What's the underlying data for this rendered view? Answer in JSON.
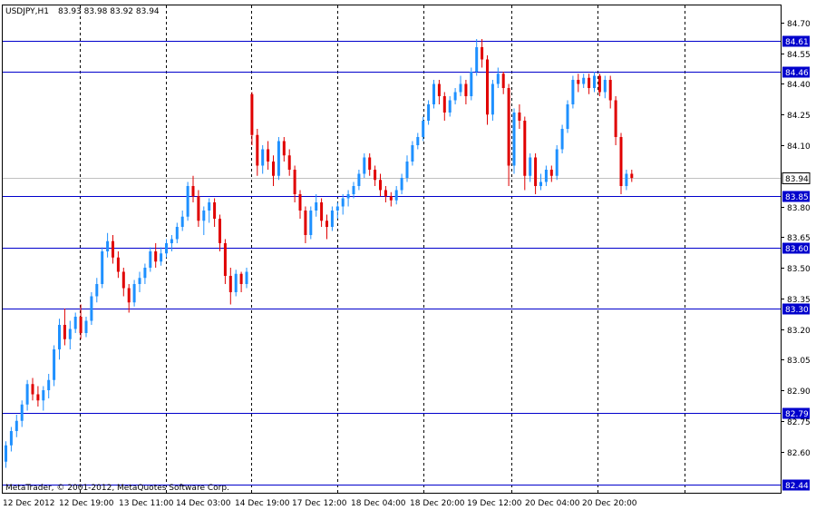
{
  "window": {
    "symbol_label": "USDJPY,H1",
    "ohlc": "83.93 83.98 83.92 83.94"
  },
  "copyright": "MetaTrader, © 2001-2012, MetaQuotes Software Corp.",
  "colors": {
    "up": "#1E90FF",
    "down": "#E00000",
    "level": "#0000CC",
    "grid": "#000000",
    "axis": "#000000",
    "current_price_line": "#C0C0C0",
    "label_text": "#ffffff"
  },
  "chart_data": {
    "type": "candlestick",
    "symbol": "USDJPY",
    "timeframe": "H1",
    "ylim": [
      82.44,
      84.72
    ],
    "price_ticks": [
      "84.70",
      "84.55",
      "84.40",
      "84.25",
      "84.10",
      "83.80",
      "83.65",
      "83.50",
      "83.35",
      "83.20",
      "83.05",
      "82.90",
      "82.75",
      "82.60"
    ],
    "time_labels": [
      "12 Dec 2012",
      "12 Dec 19:00",
      "13 Dec 11:00",
      "14 Dec 03:00",
      "14 Dec 19:00",
      "17 Dec 12:00",
      "18 Dec 04:00",
      "18 Dec 20:00",
      "19 Dec 12:00",
      "20 Dec 04:00",
      "20 Dec 20:00"
    ],
    "levels": [
      "84.61",
      "84.46",
      "83.85",
      "83.60",
      "83.30",
      "82.79",
      "82.44"
    ],
    "current_price": "83.94",
    "grid": true,
    "candles_ohlc": [
      [
        82.55,
        82.65,
        82.52,
        82.63
      ],
      [
        82.63,
        82.72,
        82.6,
        82.7
      ],
      [
        82.7,
        82.78,
        82.67,
        82.75
      ],
      [
        82.75,
        82.85,
        82.72,
        82.83
      ],
      [
        82.83,
        82.95,
        82.8,
        82.93
      ],
      [
        82.93,
        82.96,
        82.85,
        82.88
      ],
      [
        82.88,
        82.92,
        82.82,
        82.85
      ],
      [
        82.85,
        82.92,
        82.8,
        82.9
      ],
      [
        82.9,
        82.98,
        82.86,
        82.95
      ],
      [
        82.95,
        83.12,
        82.92,
        83.1
      ],
      [
        83.1,
        83.25,
        83.05,
        83.22
      ],
      [
        83.22,
        83.3,
        83.12,
        83.15
      ],
      [
        83.15,
        83.24,
        83.1,
        83.2
      ],
      [
        83.2,
        83.28,
        83.18,
        83.26
      ],
      [
        83.26,
        83.32,
        83.15,
        83.18
      ],
      [
        83.18,
        83.26,
        83.16,
        83.24
      ],
      [
        83.24,
        83.38,
        83.22,
        83.36
      ],
      [
        83.36,
        83.45,
        83.33,
        83.42
      ],
      [
        83.42,
        83.6,
        83.4,
        83.58
      ],
      [
        83.58,
        83.67,
        83.55,
        83.63
      ],
      [
        83.63,
        83.66,
        83.52,
        83.55
      ],
      [
        83.55,
        83.58,
        83.45,
        83.48
      ],
      [
        83.48,
        83.5,
        83.36,
        83.4
      ],
      [
        83.4,
        83.42,
        83.28,
        83.33
      ],
      [
        83.33,
        83.44,
        83.31,
        83.42
      ],
      [
        83.42,
        83.48,
        83.38,
        83.45
      ],
      [
        83.45,
        83.52,
        83.42,
        83.5
      ],
      [
        83.5,
        83.6,
        83.48,
        83.58
      ],
      [
        83.58,
        83.62,
        83.5,
        83.53
      ],
      [
        83.53,
        83.6,
        83.51,
        83.57
      ],
      [
        83.57,
        83.64,
        83.55,
        83.62
      ],
      [
        83.62,
        83.66,
        83.58,
        83.64
      ],
      [
        83.64,
        83.72,
        83.62,
        83.7
      ],
      [
        83.7,
        83.78,
        83.68,
        83.75
      ],
      [
        83.75,
        83.92,
        83.73,
        83.9
      ],
      [
        83.9,
        83.95,
        83.82,
        83.85
      ],
      [
        83.85,
        83.88,
        83.7,
        83.73
      ],
      [
        83.73,
        83.8,
        83.66,
        83.78
      ],
      [
        83.78,
        83.84,
        83.72,
        83.82
      ],
      [
        83.82,
        83.84,
        83.7,
        83.74
      ],
      [
        83.74,
        83.76,
        83.58,
        83.62
      ],
      [
        83.62,
        83.64,
        83.42,
        83.46
      ],
      [
        83.46,
        83.5,
        83.32,
        83.38
      ],
      [
        83.38,
        83.49,
        83.36,
        83.47
      ],
      [
        83.47,
        83.48,
        83.38,
        83.42
      ],
      [
        83.42,
        83.5,
        83.4,
        83.48
      ],
      [
        84.35,
        84.36,
        84.1,
        84.15
      ],
      [
        84.15,
        84.18,
        83.95,
        84.0
      ],
      [
        84.0,
        84.1,
        83.96,
        84.08
      ],
      [
        84.08,
        84.12,
        83.98,
        84.02
      ],
      [
        84.02,
        84.05,
        83.9,
        83.95
      ],
      [
        83.95,
        84.14,
        83.93,
        84.12
      ],
      [
        84.12,
        84.14,
        84.02,
        84.05
      ],
      [
        84.05,
        84.08,
        83.95,
        83.98
      ],
      [
        83.98,
        84.0,
        83.82,
        83.86
      ],
      [
        83.86,
        83.88,
        83.74,
        83.78
      ],
      [
        83.78,
        83.8,
        83.62,
        83.66
      ],
      [
        83.66,
        83.8,
        83.64,
        83.78
      ],
      [
        83.78,
        83.86,
        83.75,
        83.82
      ],
      [
        83.82,
        83.84,
        83.7,
        83.73
      ],
      [
        83.73,
        83.76,
        83.64,
        83.7
      ],
      [
        83.7,
        83.8,
        83.68,
        83.78
      ],
      [
        83.78,
        83.82,
        83.74,
        83.8
      ],
      [
        83.8,
        83.86,
        83.76,
        83.84
      ],
      [
        83.84,
        83.88,
        83.8,
        83.86
      ],
      [
        83.86,
        83.92,
        83.84,
        83.9
      ],
      [
        83.9,
        83.98,
        83.88,
        83.96
      ],
      [
        83.96,
        84.06,
        83.94,
        84.04
      ],
      [
        84.04,
        84.06,
        83.95,
        83.98
      ],
      [
        83.98,
        84.0,
        83.9,
        83.93
      ],
      [
        83.93,
        83.96,
        83.85,
        83.88
      ],
      [
        83.88,
        83.9,
        83.82,
        83.85
      ],
      [
        83.85,
        83.87,
        83.8,
        83.83
      ],
      [
        83.83,
        83.9,
        83.81,
        83.88
      ],
      [
        83.88,
        83.96,
        83.86,
        83.94
      ],
      [
        83.94,
        84.05,
        83.92,
        84.02
      ],
      [
        84.02,
        84.12,
        84.0,
        84.1
      ],
      [
        84.1,
        84.16,
        84.08,
        84.14
      ],
      [
        84.14,
        84.24,
        84.12,
        84.22
      ],
      [
        84.22,
        84.32,
        84.2,
        84.3
      ],
      [
        84.3,
        84.42,
        84.28,
        84.4
      ],
      [
        84.4,
        84.42,
        84.3,
        84.34
      ],
      [
        84.34,
        84.36,
        84.22,
        84.26
      ],
      [
        84.26,
        84.34,
        84.24,
        84.32
      ],
      [
        84.32,
        84.38,
        84.3,
        84.36
      ],
      [
        84.36,
        84.44,
        84.34,
        84.4
      ],
      [
        84.4,
        84.42,
        84.3,
        84.34
      ],
      [
        84.34,
        84.48,
        84.32,
        84.46
      ],
      [
        84.46,
        84.62,
        84.44,
        84.58
      ],
      [
        84.58,
        84.62,
        84.48,
        84.52
      ],
      [
        84.52,
        84.54,
        84.2,
        84.25
      ],
      [
        84.25,
        84.42,
        84.22,
        84.4
      ],
      [
        84.4,
        84.48,
        84.38,
        84.45
      ],
      [
        84.45,
        84.46,
        84.35,
        84.38
      ],
      [
        84.38,
        84.4,
        83.9,
        84.0
      ],
      [
        84.0,
        84.28,
        83.96,
        84.26
      ],
      [
        84.26,
        84.3,
        84.18,
        84.22
      ],
      [
        84.22,
        84.24,
        83.88,
        83.95
      ],
      [
        83.95,
        84.06,
        83.92,
        84.04
      ],
      [
        84.04,
        84.06,
        83.86,
        83.9
      ],
      [
        83.9,
        83.96,
        83.88,
        83.92
      ],
      [
        83.92,
        84.0,
        83.9,
        83.98
      ],
      [
        83.98,
        84.0,
        83.92,
        83.95
      ],
      [
        83.95,
        84.1,
        83.93,
        84.08
      ],
      [
        84.08,
        84.2,
        84.06,
        84.18
      ],
      [
        84.18,
        84.32,
        84.16,
        84.3
      ],
      [
        84.3,
        84.44,
        84.28,
        84.42
      ],
      [
        84.42,
        84.45,
        84.36,
        84.4
      ],
      [
        84.4,
        84.45,
        84.38,
        84.43
      ],
      [
        84.43,
        84.45,
        84.35,
        84.38
      ],
      [
        84.38,
        84.46,
        84.36,
        84.44
      ],
      [
        84.44,
        84.45,
        84.34,
        84.36
      ],
      [
        84.36,
        84.44,
        84.33,
        84.42
      ],
      [
        84.42,
        84.44,
        84.28,
        84.32
      ],
      [
        84.32,
        84.34,
        84.1,
        84.14
      ],
      [
        84.14,
        84.16,
        83.86,
        83.9
      ],
      [
        83.9,
        83.98,
        83.88,
        83.96
      ],
      [
        83.96,
        83.98,
        83.92,
        83.94
      ]
    ]
  }
}
